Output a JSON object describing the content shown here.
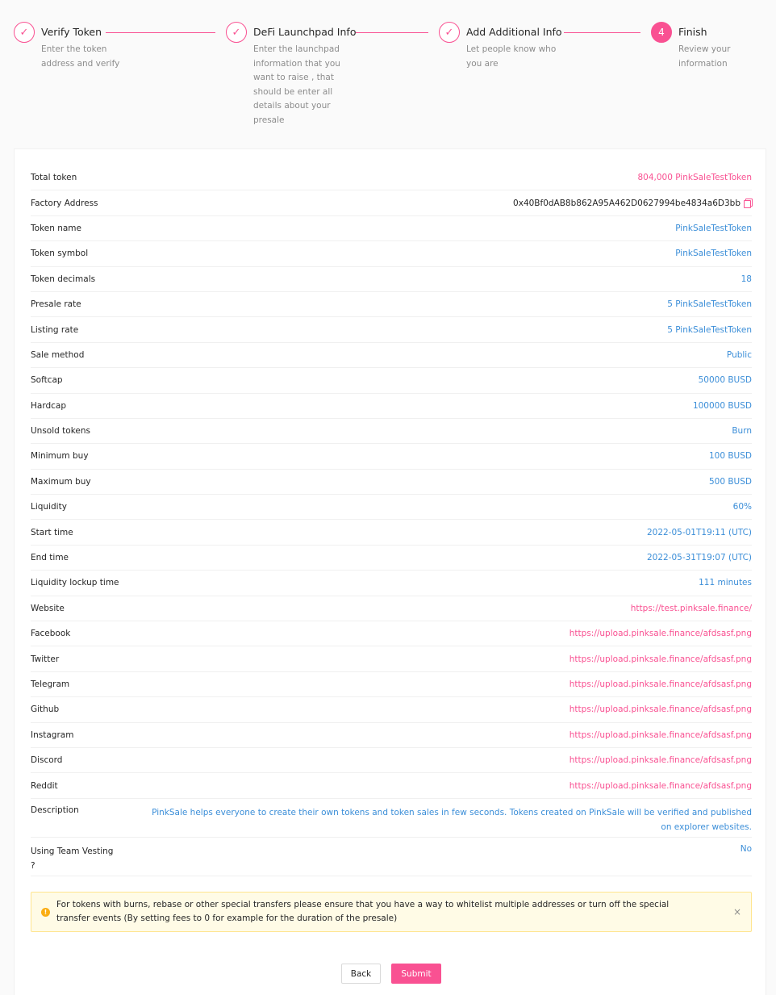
{
  "steps": [
    {
      "title": "Verify Token",
      "desc": "Enter the token address and verify",
      "state": "done"
    },
    {
      "title": "DeFi Launchpad Info",
      "desc": "Enter the launchpad information that you want to raise , that should be enter all details about your presale",
      "state": "done"
    },
    {
      "title": "Add Additional Info",
      "desc": "Let people know who you are",
      "state": "done"
    },
    {
      "title": "Finish",
      "desc": "Review your information",
      "state": "active",
      "number": "4"
    }
  ],
  "details": {
    "total_token": {
      "label": "Total token",
      "value": "804,000 PinkSaleTestToken"
    },
    "factory_address": {
      "label": "Factory Address",
      "value": "0x40Bf0dAB8b862A95A462D0627994be4834a6D3bb"
    },
    "token_name": {
      "label": "Token name",
      "value": "PinkSaleTestToken"
    },
    "token_symbol": {
      "label": "Token symbol",
      "value": "PinkSaleTestToken"
    },
    "token_decimals": {
      "label": "Token decimals",
      "value": "18"
    },
    "presale_rate": {
      "label": "Presale rate",
      "value": "5 PinkSaleTestToken"
    },
    "listing_rate": {
      "label": "Listing rate",
      "value": "5 PinkSaleTestToken"
    },
    "sale_method": {
      "label": "Sale method",
      "value": "Public"
    },
    "softcap": {
      "label": "Softcap",
      "value": "50000 BUSD"
    },
    "hardcap": {
      "label": "Hardcap",
      "value": "100000 BUSD"
    },
    "unsold_tokens": {
      "label": "Unsold tokens",
      "value": "Burn"
    },
    "minimum_buy": {
      "label": "Minimum buy",
      "value": "100 BUSD"
    },
    "maximum_buy": {
      "label": "Maximum buy",
      "value": "500 BUSD"
    },
    "liquidity": {
      "label": "Liquidity",
      "value": "60%"
    },
    "start_time": {
      "label": "Start time",
      "value": "2022-05-01T19:11 (UTC)"
    },
    "end_time": {
      "label": "End time",
      "value": "2022-05-31T19:07 (UTC)"
    },
    "lockup_time": {
      "label": "Liquidity lockup time",
      "value": "111 minutes"
    },
    "website": {
      "label": "Website",
      "value": "https://test.pinksale.finance/"
    },
    "facebook": {
      "label": "Facebook",
      "value": "https://upload.pinksale.finance/afdsasf.png"
    },
    "twitter": {
      "label": "Twitter",
      "value": "https://upload.pinksale.finance/afdsasf.png"
    },
    "telegram": {
      "label": "Telegram",
      "value": "https://upload.pinksale.finance/afdsasf.png"
    },
    "github": {
      "label": "Github",
      "value": "https://upload.pinksale.finance/afdsasf.png"
    },
    "instagram": {
      "label": "Instagram",
      "value": "https://upload.pinksale.finance/afdsasf.png"
    },
    "discord": {
      "label": "Discord",
      "value": "https://upload.pinksale.finance/afdsasf.png"
    },
    "reddit": {
      "label": "Reddit",
      "value": "https://upload.pinksale.finance/afdsasf.png"
    },
    "description": {
      "label": "Description",
      "value": "PinkSale helps everyone to create their own tokens and token sales in few seconds. Tokens created on PinkSale will be verified and published on explorer websites."
    },
    "team_vesting": {
      "label": "Using Team Vesting ?",
      "value": "No"
    }
  },
  "alert": {
    "message": "For tokens with burns, rebase or other special transfers please ensure that you have a way to whitelist multiple addresses or turn off the special transfer events (By setting fees to 0 for example for the duration of the presale)",
    "close": "×",
    "icon": "!"
  },
  "buttons": {
    "back": "Back",
    "submit": "Submit"
  },
  "colors": {
    "accent": "#f95192",
    "link_blue": "#3b8ed8"
  }
}
